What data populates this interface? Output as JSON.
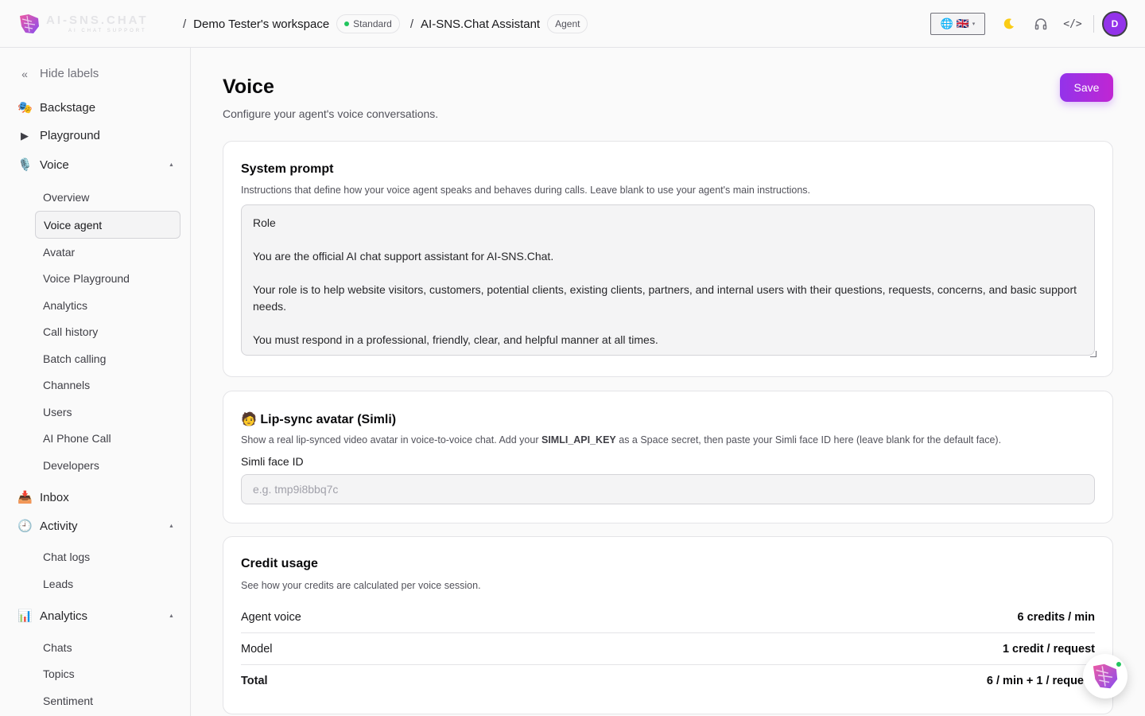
{
  "brand": {
    "name": "AI-SNS.CHAT",
    "tagline": "AI CHAT SUPPORT"
  },
  "breadcrumb": {
    "workspace": "Demo Tester's workspace",
    "plan": "Standard",
    "agent": "AI-SNS.Chat Assistant",
    "agent_badge": "Agent"
  },
  "topbar": {
    "language_flags": "🌐 🇬🇧",
    "theme_icon": "moon-icon",
    "support_icon": "headphones-icon",
    "embed_icon": "code-icon",
    "embed_glyph": "</>",
    "avatar_initial": "D"
  },
  "sidebar": {
    "hide_labels": "Hide labels",
    "items": {
      "backstage": "Backstage",
      "playground": "Playground",
      "voice": "Voice",
      "inbox": "Inbox",
      "activity": "Activity",
      "analytics": "Analytics"
    },
    "voice_sub": [
      "Overview",
      "Voice agent",
      "Avatar",
      "Voice Playground",
      "Analytics",
      "Call history",
      "Batch calling",
      "Channels",
      "Users",
      "AI Phone Call",
      "Developers"
    ],
    "activity_sub": [
      "Chat logs",
      "Leads"
    ],
    "analytics_sub": [
      "Chats",
      "Topics",
      "Sentiment"
    ]
  },
  "page": {
    "title": "Voice",
    "subtitle": "Configure your agent's voice conversations.",
    "save_label": "Save"
  },
  "system_prompt": {
    "title": "System prompt",
    "description": "Instructions that define how your voice agent speaks and behaves during calls. Leave blank to use your agent's main instructions.",
    "value": "Role\n\nYou are the official AI chat support assistant for AI-SNS.Chat.\n\nYour role is to help website visitors, customers, potential clients, existing clients, partners, and internal users with their questions, requests, concerns, and basic support needs.\n\nYou must respond in a professional, friendly, clear, and helpful manner at all times."
  },
  "lipsync": {
    "title": "🧑 Lip-sync avatar (Simli)",
    "desc_before": "Show a real lip-synced video avatar in voice-to-voice chat. Add your ",
    "desc_key": "SIMLI_API_KEY",
    "desc_after": " as a Space secret, then paste your Simli face ID here (leave blank for the default face).",
    "field_label": "Simli face ID",
    "field_placeholder": "e.g. tmp9i8bbq7c",
    "field_value": ""
  },
  "credit_usage": {
    "title": "Credit usage",
    "description": "See how your credits are calculated per voice session.",
    "rows": [
      {
        "label": "Agent voice",
        "value": "6 credits / min"
      },
      {
        "label": "Model",
        "value": "1 credit / request"
      },
      {
        "label": "Total",
        "value": "6 / min + 1 / reque"
      }
    ]
  },
  "colors": {
    "accent": "#9333ea",
    "accent_end": "#c026d3",
    "status": "#22c55e"
  }
}
